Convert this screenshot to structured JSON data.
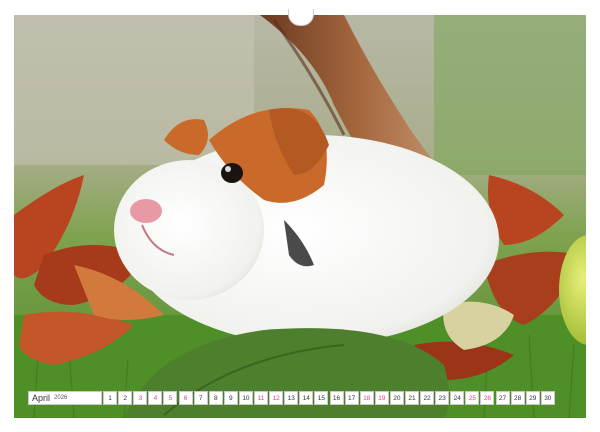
{
  "calendar": {
    "month": "April",
    "year": "2026",
    "days": [
      {
        "num": "1",
        "highlight": false
      },
      {
        "num": "2",
        "highlight": false
      },
      {
        "num": "3",
        "highlight": true
      },
      {
        "num": "4",
        "highlight": true
      },
      {
        "num": "5",
        "highlight": true
      },
      {
        "num": "6",
        "highlight": true
      },
      {
        "num": "7",
        "highlight": false
      },
      {
        "num": "8",
        "highlight": false
      },
      {
        "num": "9",
        "highlight": false
      },
      {
        "num": "10",
        "highlight": false
      },
      {
        "num": "11",
        "highlight": true
      },
      {
        "num": "12",
        "highlight": true
      },
      {
        "num": "13",
        "highlight": false
      },
      {
        "num": "14",
        "highlight": false
      },
      {
        "num": "15",
        "highlight": false
      },
      {
        "num": "16",
        "highlight": false
      },
      {
        "num": "17",
        "highlight": false
      },
      {
        "num": "18",
        "highlight": true
      },
      {
        "num": "19",
        "highlight": true
      },
      {
        "num": "20",
        "highlight": false
      },
      {
        "num": "21",
        "highlight": false
      },
      {
        "num": "22",
        "highlight": false
      },
      {
        "num": "23",
        "highlight": false
      },
      {
        "num": "24",
        "highlight": false
      },
      {
        "num": "25",
        "highlight": true
      },
      {
        "num": "26",
        "highlight": true
      },
      {
        "num": "27",
        "highlight": false
      },
      {
        "num": "28",
        "highlight": false
      },
      {
        "num": "29",
        "highlight": false
      },
      {
        "num": "30",
        "highlight": false
      }
    ]
  },
  "colors": {
    "weekend_highlight": "#e0457a",
    "grass": "#6e9e45",
    "guinea_pig_fur": "#f5f5f3",
    "guinea_pig_orange": "#c96a2a",
    "leaf_autumn": "#b8451f"
  },
  "icons": {
    "binding_holes": "binding-hole-icon",
    "hanger": "hanger-notch-icon"
  }
}
